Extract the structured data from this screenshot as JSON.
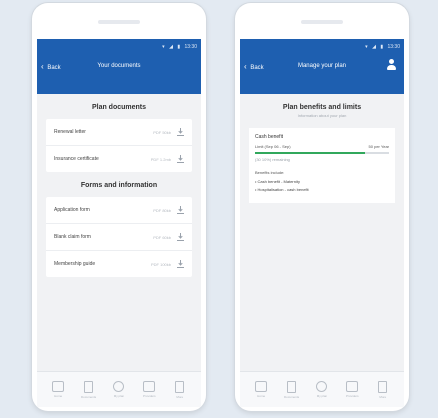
{
  "left_phone": {
    "status": {
      "time": "13:30"
    },
    "back_label": "Back",
    "title": "Your documents",
    "plan_section": {
      "title": "Plan documents",
      "items": [
        {
          "name": "Renewal letter",
          "size": "PDF 50kb"
        },
        {
          "name": "Insurance certificate",
          "size": "PDF 1.2mb"
        }
      ]
    },
    "forms_section": {
      "title": "Forms and information",
      "items": [
        {
          "name": "Application form",
          "size": "PDF 80kb"
        },
        {
          "name": "Blank claim form",
          "size": "PDF 60kb"
        },
        {
          "name": "Membership guide",
          "size": "PDF 100kb"
        }
      ]
    },
    "tabs": [
      {
        "label": "Home",
        "icon": "home-icon"
      },
      {
        "label": "Documents",
        "icon": "document-icon"
      },
      {
        "label": "My plan",
        "icon": "user-icon"
      },
      {
        "label": "Providers",
        "icon": "building-icon"
      },
      {
        "label": "More",
        "icon": "more-icon"
      }
    ]
  },
  "right_phone": {
    "status": {
      "time": "13:30"
    },
    "back_label": "Back",
    "title": "Manage your plan",
    "heading": "Plan benefits and limits",
    "subheading": "Information about your plan",
    "benefit": {
      "title": "Cash benefit",
      "limit_label": "Limit (Sep 06 - Sep)",
      "limit_value": "50 per Year",
      "progress": 0.82,
      "remaining": "(30 10%) remaining",
      "includes_title": "Benefits include:",
      "bullets": [
        "• Cash benefit - Maternity",
        "• Hospitalisation - cash benefit"
      ]
    },
    "tabs": [
      {
        "label": "Home",
        "icon": "home-icon"
      },
      {
        "label": "Documents",
        "icon": "document-icon"
      },
      {
        "label": "My plan",
        "icon": "user-icon"
      },
      {
        "label": "Providers",
        "icon": "building-icon"
      },
      {
        "label": "More",
        "icon": "more-icon"
      }
    ]
  },
  "colors": {
    "appbar": "#1e5fb0",
    "progress": "#31a85c",
    "background": "#e3eaf2"
  }
}
